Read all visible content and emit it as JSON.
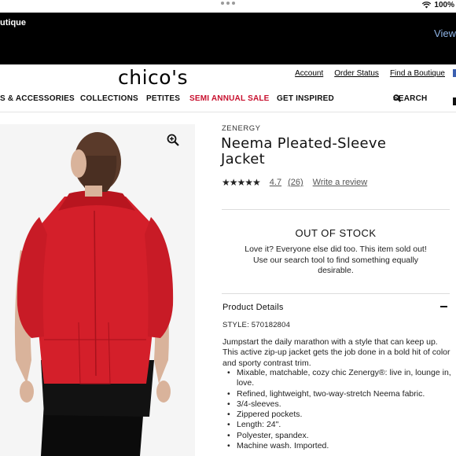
{
  "status_bar": {
    "battery": "100%",
    "wifi_icon": "wifi-icon"
  },
  "banner": {
    "left_text": "utique",
    "right_link": "View"
  },
  "header": {
    "logo": "chico's",
    "links": [
      "Account",
      "Order Status",
      "Find a Boutique"
    ]
  },
  "nav": {
    "items": [
      "S & ACCESSORIES",
      "COLLECTIONS",
      "PETITES",
      "SEMI ANNUAL SALE",
      "GET INSPIRED"
    ],
    "search": "SEARCH",
    "sale_color": "#c8102e"
  },
  "product": {
    "brand": "ZENERGY",
    "title": "Neema Pleated-Sleeve Jacket",
    "stars": "★★★★★",
    "rating": "4.7",
    "review_count": "(26)",
    "write_review": "Write a review",
    "stock_status": "OUT OF STOCK",
    "stock_message": "Love it? Everyone else did too. This item sold out! Use our search tool to find something equally desirable.",
    "details_heading": "Product Details",
    "style_number": "STYLE: 570182804",
    "description": "Jumpstart the daily marathon with a style that can keep up. This active zip-up jacket gets the job done in a bold hit of color and sporty contrast trim.",
    "bullets": [
      "Mixable, matchable, cozy chic Zenergy®: live in, lounge in, love.",
      "Refined, lightweight, two-way-stretch Neema fabric.",
      "3/4-sleeves.",
      "Zippered pockets.",
      "Length: 24\".",
      "Polyester, spandex.",
      "Machine wash. Imported."
    ],
    "jacket_color": "#d41f2a"
  }
}
